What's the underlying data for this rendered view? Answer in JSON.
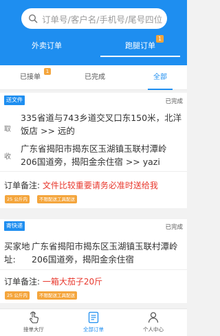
{
  "colors": {
    "accent": "#1e8ef0",
    "warning": "#e8372c",
    "badge": "#f4a53c"
  },
  "search": {
    "placeholder": "订单号/客户名/手机号/尾号四位"
  },
  "top_tabs": [
    {
      "label": "外卖订单",
      "active": false
    },
    {
      "label": "跑腿订单",
      "active": true,
      "badge": "1"
    }
  ],
  "sub_tabs": [
    {
      "label": "已接单",
      "badge": "1"
    },
    {
      "label": "已完成"
    },
    {
      "label": "全部",
      "active": true
    }
  ],
  "orders": [
    {
      "type": "送文件",
      "status": "已完成",
      "pickup_label": "取",
      "pickup_addr": "335省道与743乡道交叉口东150米，北洋饭店 >> 远的",
      "deliver_label": "收",
      "deliver_addr": "广东省揭阳市揭东区玉湖镇玉联村潭岭206国道旁，揭阳金余住宿 >> yazi",
      "note_label": "订单备注:",
      "note": "文件比较重要请务必准时送给我",
      "weight": "25 公斤内",
      "tool": "不限配送工具配送"
    },
    {
      "type": "寄快递",
      "status": "已完成",
      "buyer_label": "买家地址:",
      "buyer_addr": "广东省揭阳市揭东区玉湖镇玉联村潭岭206国道旁，揭阳金余住宿",
      "note_label": "订单备注:",
      "note": "一箱大茄子20斤",
      "weight": "25 公斤内",
      "tool": "不限配送工具配送"
    }
  ],
  "bottom_nav": [
    {
      "label": "接单大厅",
      "icon": "hand-pointer-icon"
    },
    {
      "label": "全部订单",
      "icon": "order-list-icon",
      "active": true
    },
    {
      "label": "个人中心",
      "icon": "person-icon"
    }
  ]
}
